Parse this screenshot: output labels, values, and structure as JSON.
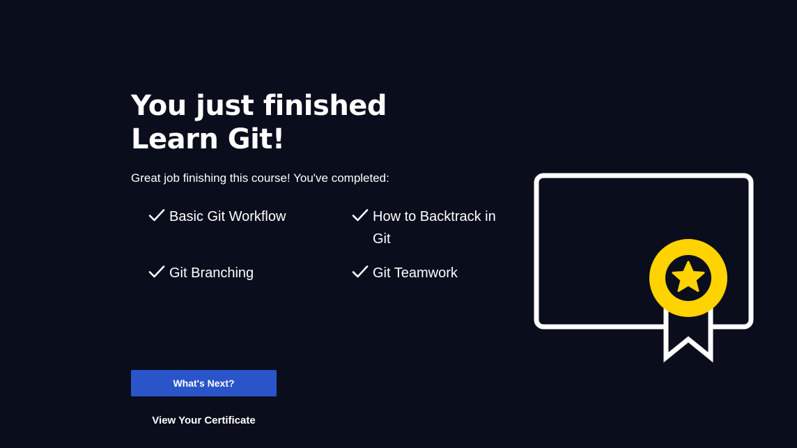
{
  "heading": {
    "line1": "You just finished",
    "line2": "Learn Git!"
  },
  "subtitle": "Great job finishing this course! You've completed:",
  "skills": [
    {
      "label": "Basic Git Workflow",
      "icon": "checkmark-icon"
    },
    {
      "label": "How to Backtrack in Git",
      "icon": "checkmark-icon"
    },
    {
      "label": "Git Branching",
      "icon": "checkmark-icon"
    },
    {
      "label": "Git Teamwork",
      "icon": "checkmark-icon"
    }
  ],
  "actions": {
    "whats_next_label": "What's Next?",
    "view_certificate_label": "View Your Certificate"
  },
  "illustration": {
    "icon": "certificate-icon",
    "badge_icon": "star-badge-icon"
  },
  "colors": {
    "background": "#0a0d1c",
    "text": "#ffffff",
    "button": "#2a55c9",
    "badge": "#ffd300"
  }
}
